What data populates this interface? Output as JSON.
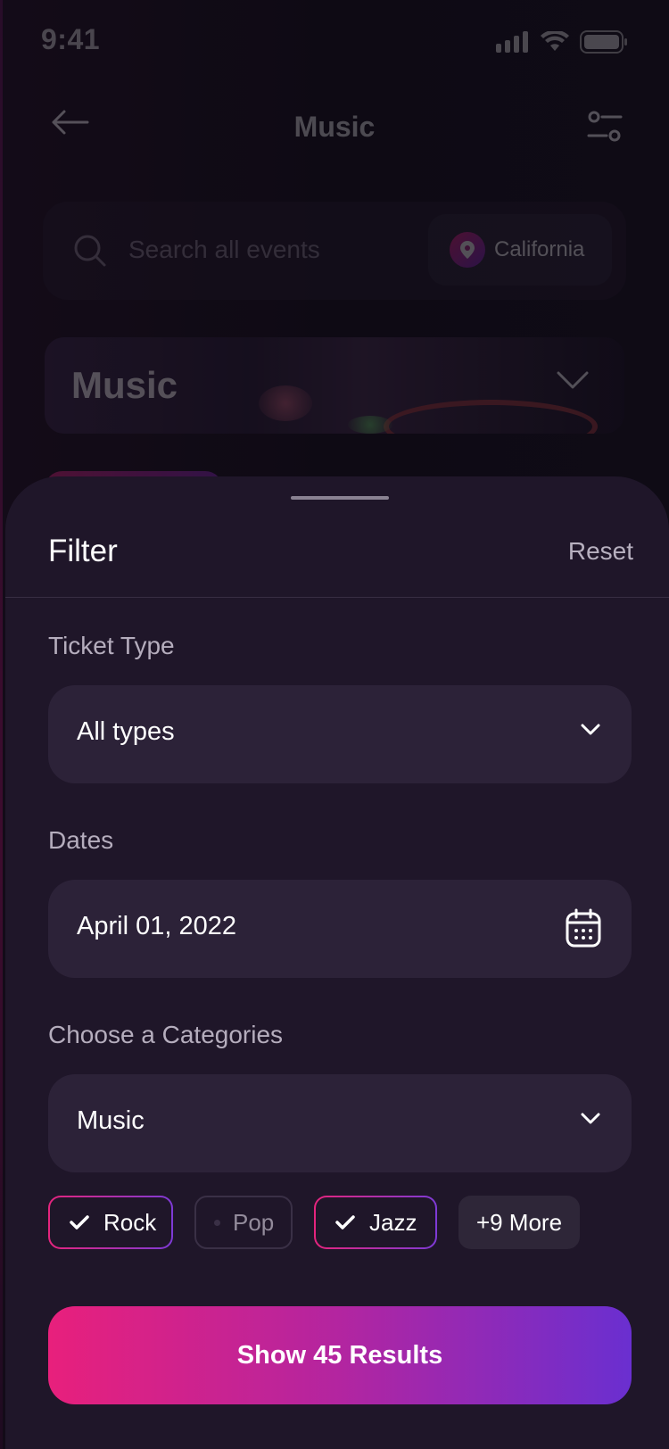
{
  "status_bar": {
    "time": "9:41"
  },
  "header": {
    "title": "Music"
  },
  "search": {
    "placeholder": "Search all events",
    "location": "California"
  },
  "banner": {
    "title": "Music"
  },
  "filter_sheet": {
    "title": "Filter",
    "reset_label": "Reset",
    "ticket_type": {
      "label": "Ticket Type",
      "value": "All types"
    },
    "dates": {
      "label": "Dates",
      "value": "April 01, 2022"
    },
    "categories": {
      "label": "Choose a Categories",
      "value": "Music",
      "chips": [
        {
          "label": "Rock",
          "selected": true
        },
        {
          "label": "Pop",
          "selected": false
        },
        {
          "label": "Jazz",
          "selected": true
        },
        {
          "label": "+9 More",
          "selected": false
        }
      ]
    },
    "cta_label": "Show 45 Results"
  },
  "colors": {
    "accent_pink": "#e8207c",
    "accent_purple": "#6a2fd0",
    "sheet_bg": "#1f1629",
    "field_bg": "#2c2238"
  }
}
